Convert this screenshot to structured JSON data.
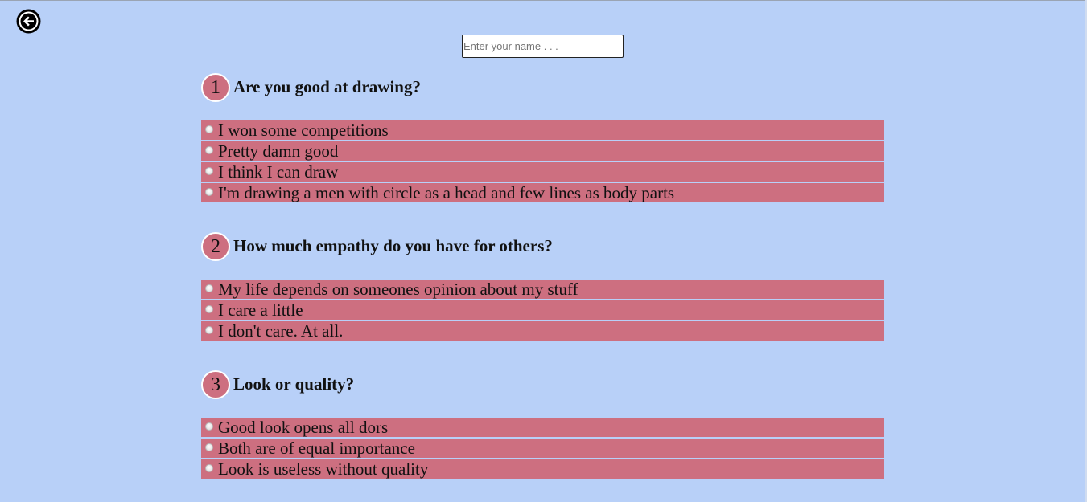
{
  "name_input": {
    "placeholder": "Enter your name . . .",
    "value": ""
  },
  "icons": {
    "back": "arrow-left-circle-icon",
    "radio": "radio-button-icon"
  },
  "colors": {
    "background": "#b8d0f8",
    "accent": "#cd6f80"
  },
  "questions": [
    {
      "number": "1",
      "text": "Are you good at drawing?",
      "options": [
        "I won some competitions",
        "Pretty damn good",
        "I think I can draw",
        "I'm drawing a men with circle as a head and few lines as body parts"
      ]
    },
    {
      "number": "2",
      "text": "How much empathy do you have for others?",
      "options": [
        "My life depends on someones opinion about my stuff",
        "I care a little",
        "I don't care. At all."
      ]
    },
    {
      "number": "3",
      "text": "Look or quality?",
      "options": [
        "Good look opens all dors",
        "Both are of equal importance",
        "Look is useless without quality"
      ]
    }
  ]
}
